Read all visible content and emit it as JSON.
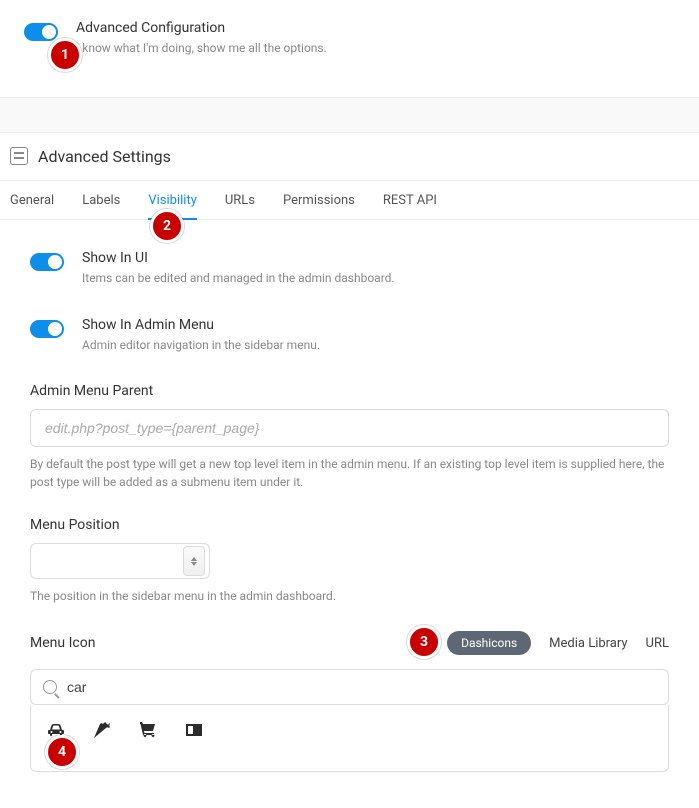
{
  "advanced": {
    "title": "Advanced Configuration",
    "desc": "I know what I'm doing, show me all the options."
  },
  "section": {
    "title": "Advanced Settings"
  },
  "tabs": {
    "general": "General",
    "labels": "Labels",
    "visibility": "Visibility",
    "urls": "URLs",
    "permissions": "Permissions",
    "restapi": "REST API"
  },
  "showInUi": {
    "title": "Show In UI",
    "desc": "Items can be edited and managed in the admin dashboard."
  },
  "showInAdminMenu": {
    "title": "Show In Admin Menu",
    "desc": "Admin editor navigation in the sidebar menu."
  },
  "adminMenuParent": {
    "label": "Admin Menu Parent",
    "placeholder": "edit.php?post_type={parent_page}",
    "help": "By default the post type will get a new top level item in the admin menu. If an existing top level item is supplied here, the post type will be added as a submenu item under it."
  },
  "menuPosition": {
    "label": "Menu Position",
    "help": "The position in the sidebar menu in the admin dashboard."
  },
  "menuIcon": {
    "label": "Menu Icon",
    "seg": {
      "dashicons": "Dashicons",
      "media": "Media Library",
      "url": "URL"
    },
    "searchValue": "car"
  },
  "badges": {
    "b1": "1",
    "b2": "2",
    "b3": "3",
    "b4": "4"
  }
}
